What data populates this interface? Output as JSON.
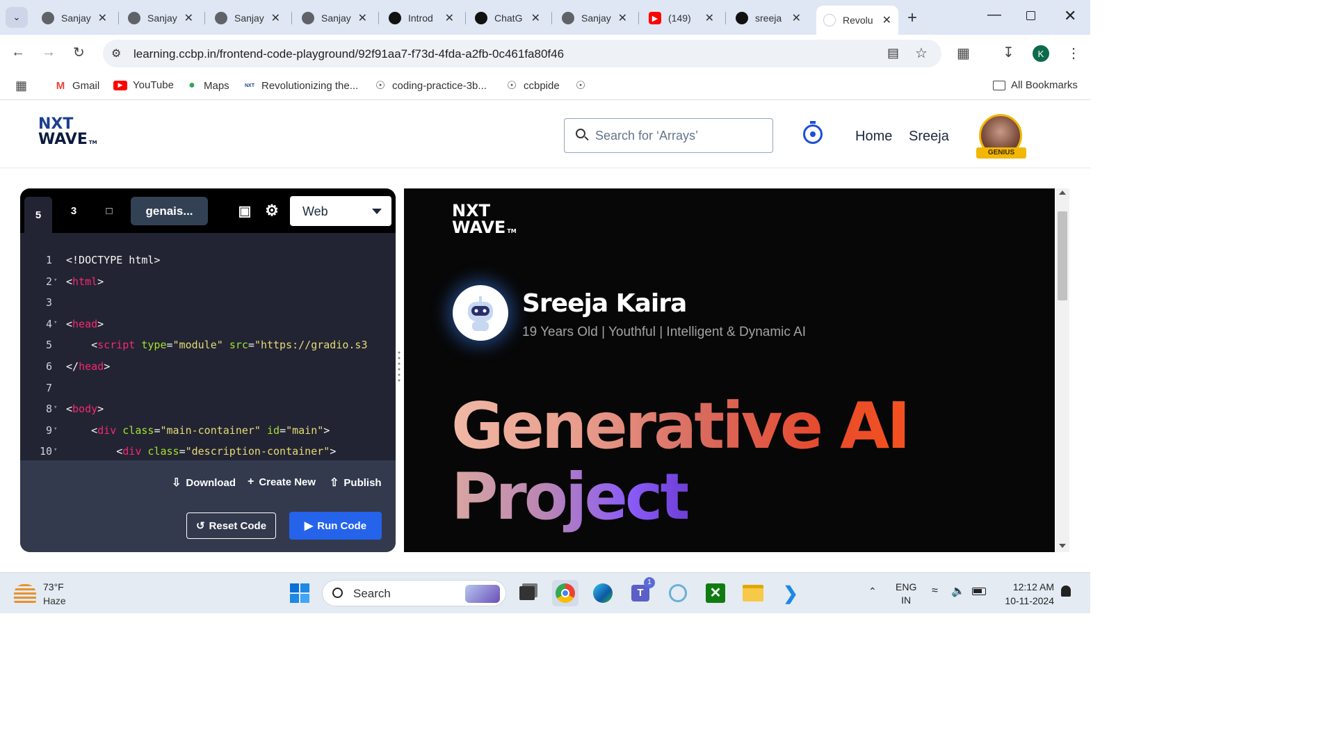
{
  "browser": {
    "tabs": [
      {
        "title": "Sanjay",
        "icon": "globe-icon"
      },
      {
        "title": "Sanjay",
        "icon": "globe-icon"
      },
      {
        "title": "Sanjay",
        "icon": "globe-icon"
      },
      {
        "title": "Sanjay",
        "icon": "globe-icon"
      },
      {
        "title": "Introd",
        "icon": "chatgpt-icon"
      },
      {
        "title": "ChatG",
        "icon": "chatgpt-icon"
      },
      {
        "title": "Sanjay",
        "icon": "globe-icon"
      },
      {
        "title": "(149)",
        "icon": "youtube-icon"
      },
      {
        "title": "sreeja",
        "icon": "github-icon"
      },
      {
        "title": "Revolu",
        "icon": "nxtwave-icon",
        "active": true
      }
    ],
    "url": "learning.ccbp.in/frontend-code-playground/92f91aa7-f73d-4fda-a2fb-0c461fa80f46",
    "profile_initial": "K",
    "bookmarks": [
      "Gmail",
      "YouTube",
      "Maps",
      "Revolutionizing the...",
      "coding-practice-3b...",
      "ccbpide"
    ],
    "all_bookmarks": "All Bookmarks"
  },
  "site": {
    "logo_line1": "NXT",
    "logo_line2": "WAVE",
    "logo_tm": "TM",
    "search_placeholder": "Search for ‘Arrays’",
    "nav_home": "Home",
    "nav_user": "Sreeja",
    "badge": "GENIUS"
  },
  "editor": {
    "file_name": "genais...",
    "mode": "Web",
    "lines": [
      {
        "n": "1",
        "fold": false,
        "html": "&lt;!DOCTYPE html&gt;"
      },
      {
        "n": "2",
        "fold": true,
        "html": "&lt;<span class='tg'>html</span>&gt;"
      },
      {
        "n": "3",
        "fold": false,
        "html": ""
      },
      {
        "n": "4",
        "fold": true,
        "html": "&lt;<span class='tg'>head</span>&gt;"
      },
      {
        "n": "5",
        "fold": false,
        "html": "    &lt;<span class='tg'>script</span> <span class='at'>type</span>=<span class='st'>\"module\"</span> <span class='at'>src</span>=<span class='st'>\"https://gradio.s3</span>"
      },
      {
        "n": "6",
        "fold": false,
        "html": "&lt;/<span class='tg'>head</span>&gt;"
      },
      {
        "n": "7",
        "fold": false,
        "html": ""
      },
      {
        "n": "8",
        "fold": true,
        "html": "&lt;<span class='tg'>body</span>&gt;"
      },
      {
        "n": "9",
        "fold": true,
        "html": "    &lt;<span class='tg'>div</span> <span class='at'>class</span>=<span class='st'>\"main-container\"</span> <span class='at'>id</span>=<span class='st'>\"main\"</span>&gt;"
      },
      {
        "n": "10",
        "fold": true,
        "html": "        &lt;<span class='tg'>div</span> <span class='at'>class</span>=<span class='st'>\"description-container\"</span>&gt;"
      }
    ],
    "download": "Download",
    "create_new": "Create New",
    "publish": "Publish",
    "reset": "Reset Code",
    "run": "Run Code"
  },
  "preview": {
    "logo_line1": "NXT",
    "logo_line2": "WAVE",
    "logo_tm": "TM",
    "name": "Sreeja Kaira",
    "tagline": "19 Years Old | Youthful | Intelligent & Dynamic AI",
    "heading_line1": "Generative AI",
    "heading_line2": "Project"
  },
  "taskbar": {
    "weather_temp": "73°F",
    "weather_desc": "Haze",
    "search": "Search",
    "lang1": "ENG",
    "lang2": "IN",
    "time": "12:12 AM",
    "date": "10-11-2024",
    "teams_badge": "1"
  }
}
